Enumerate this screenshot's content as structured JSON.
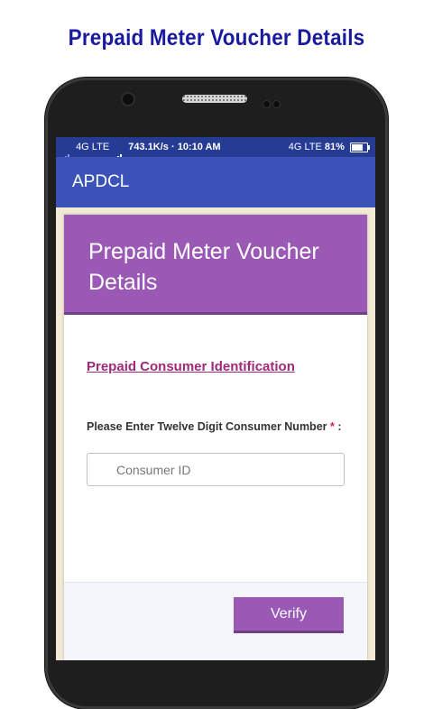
{
  "promo": {
    "title": "Prepaid Meter Voucher Details"
  },
  "status_bar": {
    "network_left": "4G LTE",
    "speed_time": "743.1K/s · 10:10 AM",
    "network_right": "4G LTE",
    "battery": "81%"
  },
  "app_bar": {
    "title": "APDCL"
  },
  "card": {
    "title": "Prepaid Meter Voucher Details",
    "section_link": "Prepaid Consumer Identification",
    "field_label": "Please Enter Twelve Digit Consumer Number",
    "required_mark": "*",
    "label_suffix": " :",
    "input": {
      "placeholder": "Consumer ID",
      "value": ""
    },
    "verify_label": "Verify"
  },
  "colors": {
    "promo_title": "#1a1a9e",
    "status_bar": "#253b94",
    "app_bar": "#3b53b9",
    "card_header": "#9b59b6",
    "link": "#a0277a",
    "required": "#e0203a"
  }
}
